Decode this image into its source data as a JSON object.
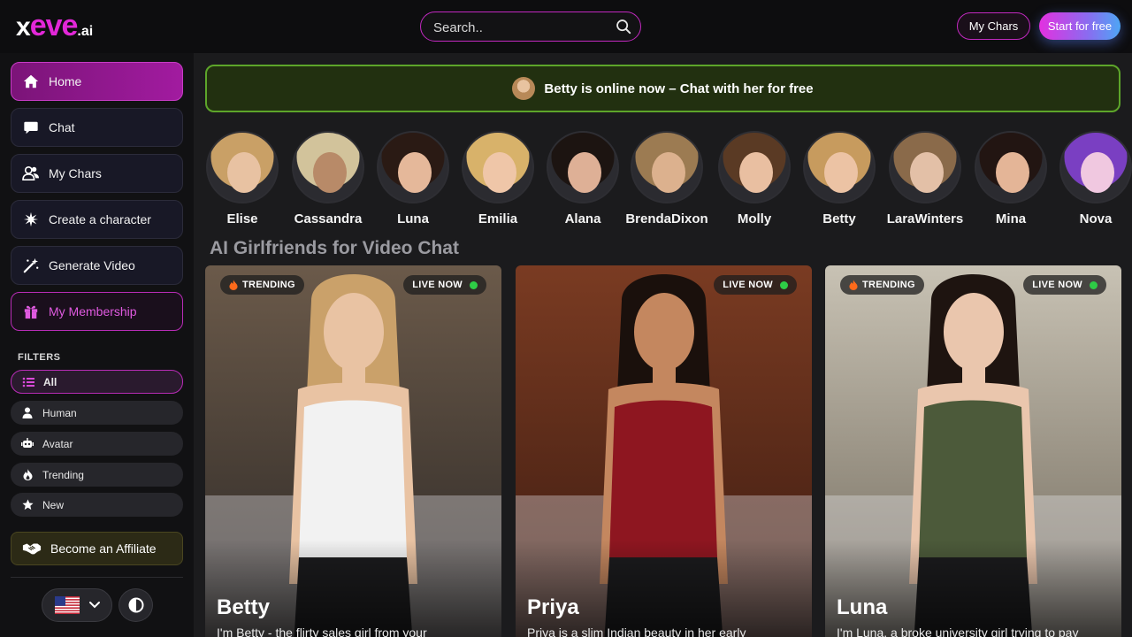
{
  "header": {
    "logo": {
      "x": "x",
      "eve": "eve",
      "ai": ".ai"
    },
    "search_placeholder": "Search..",
    "my_chars_label": "My Chars",
    "start_label": "Start for free"
  },
  "sidebar": {
    "nav": [
      {
        "label": "Home",
        "icon": "home-icon"
      },
      {
        "label": "Chat",
        "icon": "chat-icon"
      },
      {
        "label": "My Chars",
        "icon": "users-icon"
      },
      {
        "label": "Create a character",
        "icon": "sparkle-icon"
      },
      {
        "label": "Generate Video",
        "icon": "magic-wand-icon"
      },
      {
        "label": "My Membership",
        "icon": "gift-icon"
      }
    ],
    "filters_title": "FILTERS",
    "filters": [
      {
        "label": "All",
        "icon": "list-icon"
      },
      {
        "label": "Human",
        "icon": "person-icon"
      },
      {
        "label": "Avatar",
        "icon": "robot-icon"
      },
      {
        "label": "Trending",
        "icon": "flame-icon"
      },
      {
        "label": "New",
        "icon": "star-icon"
      }
    ],
    "affiliate_label": "Become an Affiliate",
    "language": "US",
    "theme_icon": "contrast-icon"
  },
  "banner": {
    "text": "Betty is online now – Chat with her for free"
  },
  "stories": [
    {
      "name": "Elise",
      "hair": "#c9a066",
      "skin": "#e8c2a2"
    },
    {
      "name": "Cassandra",
      "hair": "#d2c39b",
      "skin": "#b88a68"
    },
    {
      "name": "Luna",
      "hair": "#2a1a14",
      "skin": "#e5b89a"
    },
    {
      "name": "Emilia",
      "hair": "#d8b26a",
      "skin": "#efc6a8"
    },
    {
      "name": "Alana",
      "hair": "#1c1411",
      "skin": "#deb096"
    },
    {
      "name": "BrendaDixon",
      "hair": "#9c7b52",
      "skin": "#dcb18e"
    },
    {
      "name": "Molly",
      "hair": "#5a3a24",
      "skin": "#e9bfa1"
    },
    {
      "name": "Betty",
      "hair": "#c79b5e",
      "skin": "#ecc3a4"
    },
    {
      "name": "LaraWinters",
      "hair": "#8a6a4a",
      "skin": "#e3c0a7"
    },
    {
      "name": "Mina",
      "hair": "#221512",
      "skin": "#e4b597"
    },
    {
      "name": "Nova",
      "hair": "#7a3fc2",
      "skin": "#f0c8e0"
    }
  ],
  "section_title": "AI Girlfriends for Video Chat",
  "cards": [
    {
      "name": "Betty",
      "desc": "I'm Betty - the flirty sales girl from your",
      "trending": "TRENDING",
      "live": "LIVE NOW",
      "show_trending": true,
      "bg1": "#6b5a4a",
      "bg2": "#2a2624",
      "skin": "#e9c3a3",
      "hair": "#caa16a",
      "top": "#f2f2f2"
    },
    {
      "name": "Priya",
      "desc": "Priya is a slim Indian beauty in her early",
      "trending": "",
      "live": "LIVE NOW",
      "show_trending": false,
      "bg1": "#7a3b22",
      "bg2": "#3a1a10",
      "skin": "#c4875f",
      "hair": "#1a100c",
      "top": "#8e1620"
    },
    {
      "name": "Luna",
      "desc": "I'm Luna, a broke university girl trying to pay",
      "trending": "TRENDING",
      "live": "LIVE NOW",
      "show_trending": true,
      "bg1": "#c8c2b4",
      "bg2": "#6e6658",
      "skin": "#eac6ad",
      "hair": "#1e1410",
      "top": "#4c5a3a"
    }
  ]
}
